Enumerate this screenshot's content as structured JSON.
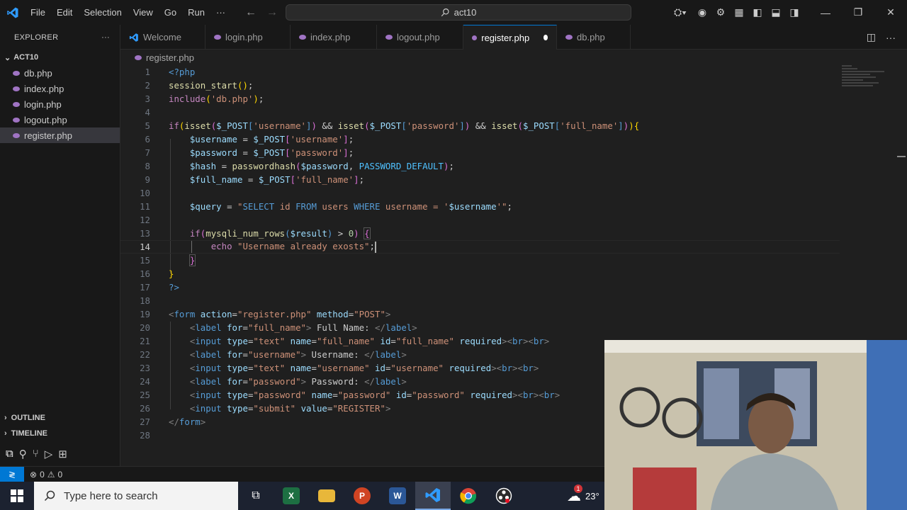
{
  "menu": [
    "File",
    "Edit",
    "Selection",
    "View",
    "Go",
    "Run",
    "···"
  ],
  "command_center": "act10",
  "sidebar": {
    "title": "EXPLORER",
    "folder": "ACT10",
    "files": [
      "db.php",
      "index.php",
      "login.php",
      "logout.php",
      "register.php"
    ],
    "active_file": "register.php",
    "outline": "OUTLINE",
    "timeline": "TIMELINE"
  },
  "tabs": [
    {
      "label": "Welcome"
    },
    {
      "label": "login.php"
    },
    {
      "label": "index.php"
    },
    {
      "label": "logout.php"
    },
    {
      "label": "register.php",
      "active": true,
      "modified": true
    },
    {
      "label": "db.php"
    }
  ],
  "breadcrumb": "register.php",
  "editor": {
    "current_line": 14,
    "line_numbers": [
      "1",
      "2",
      "3",
      "4",
      "5",
      "6",
      "7",
      "8",
      "9",
      "10",
      "11",
      "12",
      "13",
      "14",
      "15",
      "16",
      "17",
      "18",
      "19",
      "20",
      "21",
      "22",
      "23",
      "24",
      "25",
      "26",
      "27",
      "28"
    ]
  },
  "status": {
    "errors": "0",
    "warnings": "0"
  },
  "taskbar": {
    "search_placeholder": "Type here to search",
    "weather_temp": "23°",
    "weather_badge": "1"
  },
  "colors": {
    "accent": "#0078d4",
    "editor_bg": "#1f1f1f",
    "sidebar_bg": "#181818"
  }
}
